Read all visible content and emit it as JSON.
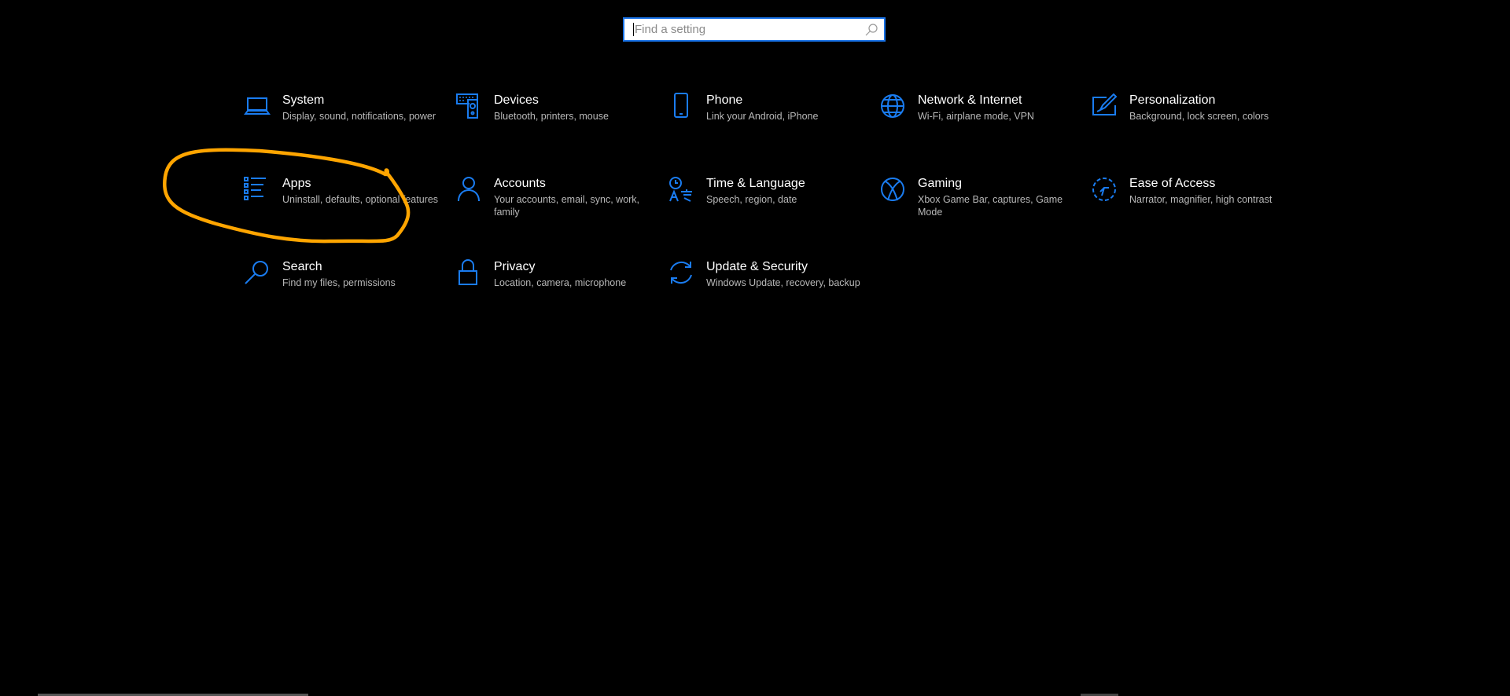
{
  "search": {
    "placeholder": "Find a setting"
  },
  "tiles": [
    {
      "title": "System",
      "desc": "Display, sound, notifications, power"
    },
    {
      "title": "Devices",
      "desc": "Bluetooth, printers, mouse"
    },
    {
      "title": "Phone",
      "desc": "Link your Android, iPhone"
    },
    {
      "title": "Network & Internet",
      "desc": "Wi-Fi, airplane mode, VPN"
    },
    {
      "title": "Personalization",
      "desc": "Background, lock screen, colors"
    },
    {
      "title": "Apps",
      "desc": "Uninstall, defaults, optional features"
    },
    {
      "title": "Accounts",
      "desc": "Your accounts, email, sync, work, family"
    },
    {
      "title": "Time & Language",
      "desc": "Speech, region, date"
    },
    {
      "title": "Gaming",
      "desc": "Xbox Game Bar, captures, Game Mode"
    },
    {
      "title": "Ease of Access",
      "desc": "Narrator, magnifier, high contrast"
    },
    {
      "title": "Search",
      "desc": "Find my files, permissions"
    },
    {
      "title": "Privacy",
      "desc": "Location, camera, microphone"
    },
    {
      "title": "Update & Security",
      "desc": "Windows Update, recovery, backup"
    }
  ],
  "colors": {
    "accent": "#1a7cf0",
    "annotation": "#ffa500",
    "background": "#000000"
  }
}
